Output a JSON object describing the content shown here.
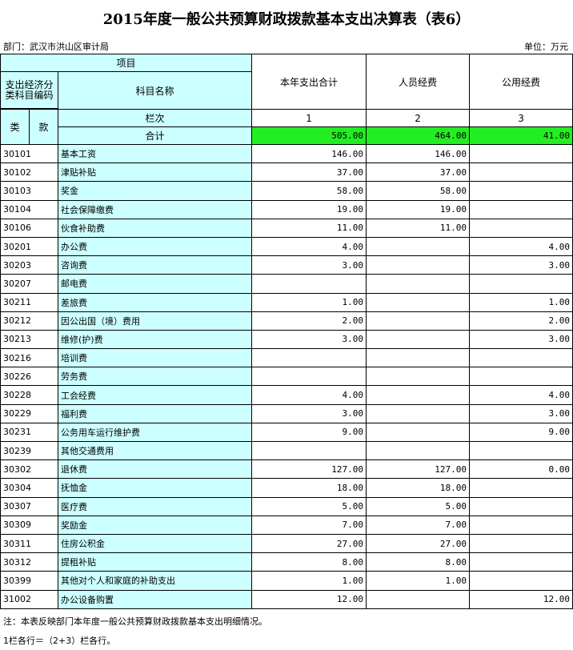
{
  "title": "2015年度一般公共预算财政拨款基本支出决算表（表6）",
  "dept": "部门：武汉市洪山区审计局",
  "unit": "单位：万元",
  "header": {
    "xiangmu": "项目",
    "code_label": "支出经济分类科目编码",
    "name_label": "科目名称",
    "lei": "类",
    "kuan": "款",
    "lanci": "栏次",
    "col1": "本年支出合计",
    "col2": "人员经费",
    "col3": "公用经费",
    "idx1": "1",
    "idx2": "2",
    "idx3": "3"
  },
  "total": {
    "label": "合计",
    "v1": "505.00",
    "v2": "464.00",
    "v3": "41.00"
  },
  "rows": [
    {
      "code": "30101",
      "name": "基本工资",
      "v1": "146.00",
      "v2": "146.00",
      "v3": ""
    },
    {
      "code": "30102",
      "name": "津贴补贴",
      "v1": "37.00",
      "v2": "37.00",
      "v3": ""
    },
    {
      "code": "30103",
      "name": "奖金",
      "v1": "58.00",
      "v2": "58.00",
      "v3": ""
    },
    {
      "code": "30104",
      "name": "社会保障缴费",
      "v1": "19.00",
      "v2": "19.00",
      "v3": ""
    },
    {
      "code": "30106",
      "name": "伙食补助费",
      "v1": "11.00",
      "v2": "11.00",
      "v3": ""
    },
    {
      "code": "30201",
      "name": "办公费",
      "v1": "4.00",
      "v2": "",
      "v3": "4.00"
    },
    {
      "code": "30203",
      "name": "咨询费",
      "v1": "3.00",
      "v2": "",
      "v3": "3.00"
    },
    {
      "code": "30207",
      "name": "邮电费",
      "v1": "",
      "v2": "",
      "v3": ""
    },
    {
      "code": "30211",
      "name": "差旅费",
      "v1": "1.00",
      "v2": "",
      "v3": "1.00"
    },
    {
      "code": "30212",
      "name": "因公出国（境）费用",
      "v1": "2.00",
      "v2": "",
      "v3": "2.00"
    },
    {
      "code": "30213",
      "name": "维修(护)费",
      "v1": "3.00",
      "v2": "",
      "v3": "3.00"
    },
    {
      "code": "30216",
      "name": "培训费",
      "v1": "",
      "v2": "",
      "v3": ""
    },
    {
      "code": "30226",
      "name": "劳务费",
      "v1": "",
      "v2": "",
      "v3": ""
    },
    {
      "code": "30228",
      "name": "工会经费",
      "v1": "4.00",
      "v2": "",
      "v3": "4.00"
    },
    {
      "code": "30229",
      "name": "福利费",
      "v1": "3.00",
      "v2": "",
      "v3": "3.00"
    },
    {
      "code": "30231",
      "name": "公务用车运行维护费",
      "v1": "9.00",
      "v2": "",
      "v3": "9.00"
    },
    {
      "code": "30239",
      "name": "其他交通费用",
      "v1": "",
      "v2": "",
      "v3": ""
    },
    {
      "code": "30302",
      "name": "退休费",
      "v1": "127.00",
      "v2": "127.00",
      "v3": "0.00"
    },
    {
      "code": "30304",
      "name": "抚恤金",
      "v1": "18.00",
      "v2": "18.00",
      "v3": ""
    },
    {
      "code": "30307",
      "name": "医疗费",
      "v1": "5.00",
      "v2": "5.00",
      "v3": ""
    },
    {
      "code": "30309",
      "name": "奖励金",
      "v1": "7.00",
      "v2": "7.00",
      "v3": ""
    },
    {
      "code": "30311",
      "name": "住房公积金",
      "v1": "27.00",
      "v2": "27.00",
      "v3": ""
    },
    {
      "code": "30312",
      "name": "提租补贴",
      "v1": "8.00",
      "v2": "8.00",
      "v3": ""
    },
    {
      "code": "30399",
      "name": "其他对个人和家庭的补助支出",
      "v1": "1.00",
      "v2": "1.00",
      "v3": ""
    },
    {
      "code": "31002",
      "name": "办公设备购置",
      "v1": "12.00",
      "v2": "",
      "v3": "12.00"
    }
  ],
  "notes": [
    "注：本表反映部门本年度一般公共预算财政拨款基本支出明细情况。",
    "1栏各行＝（2+3）栏各行。"
  ]
}
